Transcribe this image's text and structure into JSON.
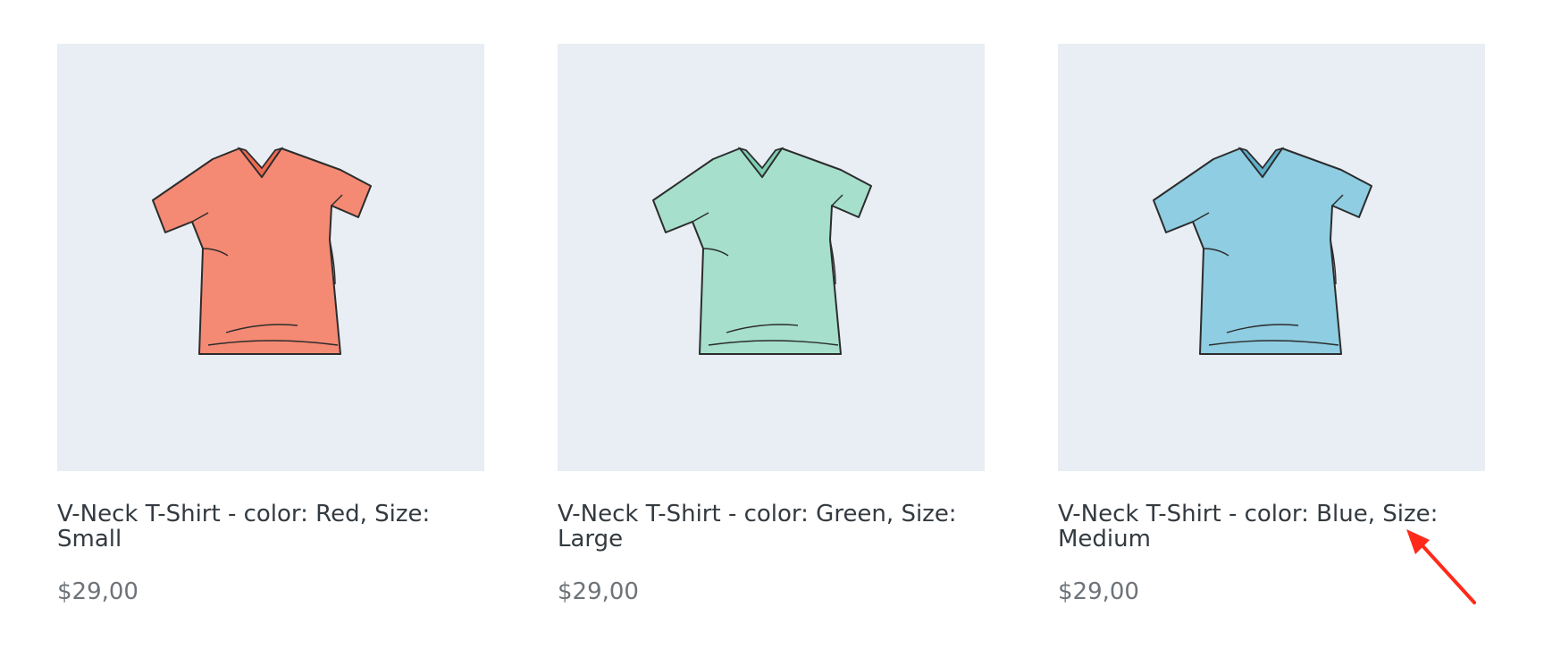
{
  "products": [
    {
      "title": "V-Neck T-Shirt - color: Red, Size: Small",
      "price": "$29,00",
      "icon": "tshirt-red-icon",
      "color": "#f58a74",
      "shade": "#ee6a52"
    },
    {
      "title": "V-Neck T-Shirt - color: Green, Size: Large",
      "price": "$29,00",
      "icon": "tshirt-green-icon",
      "color": "#a6e0cc",
      "shade": "#7fcfb2"
    },
    {
      "title": "V-Neck T-Shirt - color: Blue, Size: Medium",
      "price": "$29,00",
      "icon": "tshirt-blue-icon",
      "color": "#8fcde2",
      "shade": "#5fb0cc"
    }
  ],
  "annotation": {
    "icon": "red-arrow-icon",
    "color": "#ff2a1a"
  },
  "colors": {
    "image_bg": "#e8eef3",
    "title_text": "#333a40",
    "price_text": "#6d7378"
  }
}
